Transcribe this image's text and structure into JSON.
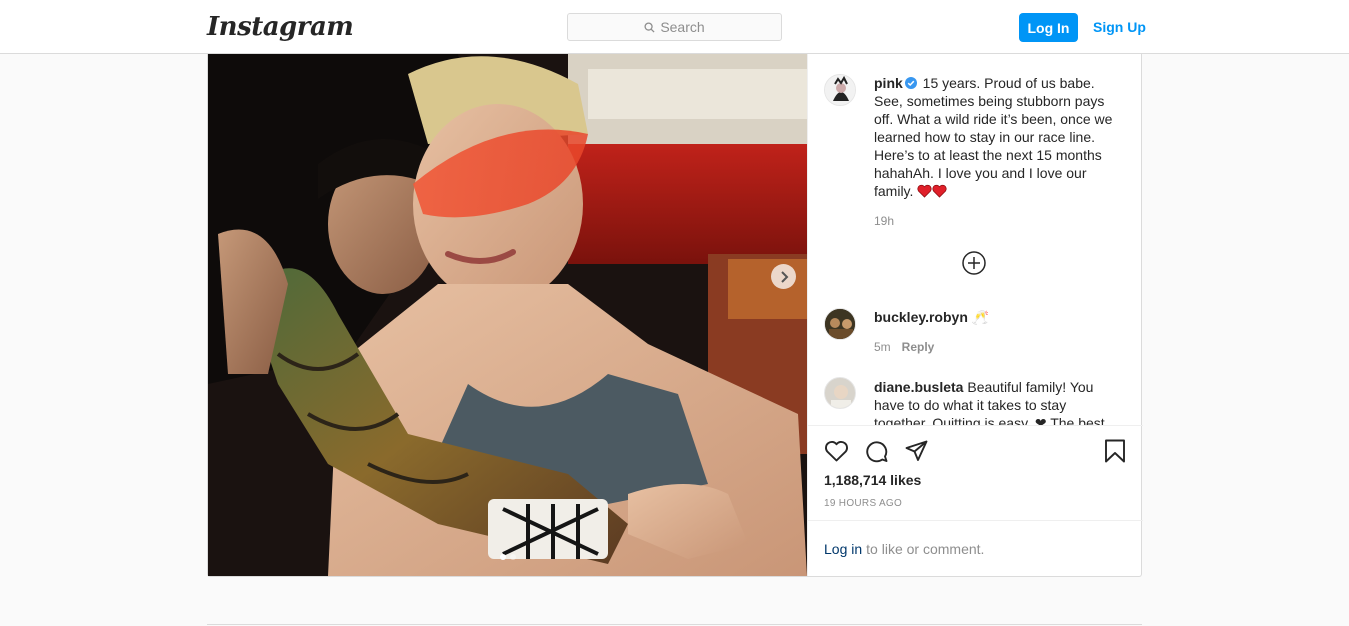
{
  "header": {
    "logo": "Instagram",
    "search_placeholder": "Search",
    "login_label": "Log In",
    "signup_label": "Sign Up"
  },
  "post": {
    "author": {
      "username": "pink",
      "verified": true
    },
    "caption": "15 years. Proud of us babe. See, sometimes being stubborn pays off. What a wild ride it’s been, once we learned how to stay in our race line. Here’s to at least the next 15 months hahahAh. I love you and I love our family.",
    "caption_age": "19h",
    "carousel": {
      "total_slides": 2,
      "active_index": 0
    },
    "comments": [
      {
        "username": "buckley.robyn",
        "text": "🥂",
        "age": "5m",
        "reply_label": "Reply"
      },
      {
        "username": "diane.busleta",
        "text": "Beautiful family! You have to do what it takes to stay together. Quitting is easy. ❤ The best"
      }
    ],
    "likes": "1,188,714 likes",
    "timestamp": "19 HOURS AGO",
    "login_prompt": {
      "link": "Log in",
      "rest": "to like or comment."
    }
  },
  "colors": {
    "accent": "#0095f6",
    "verified": "#3897f0",
    "heart": "#ed4956",
    "text": "#262626",
    "muted": "#8e8e8e"
  },
  "icons": [
    "search-icon",
    "verified-badge-icon",
    "heart-emoji-icon",
    "plus-circle-icon",
    "chevron-right-icon",
    "like-heart-icon",
    "comment-icon",
    "share-icon",
    "bookmark-icon"
  ]
}
